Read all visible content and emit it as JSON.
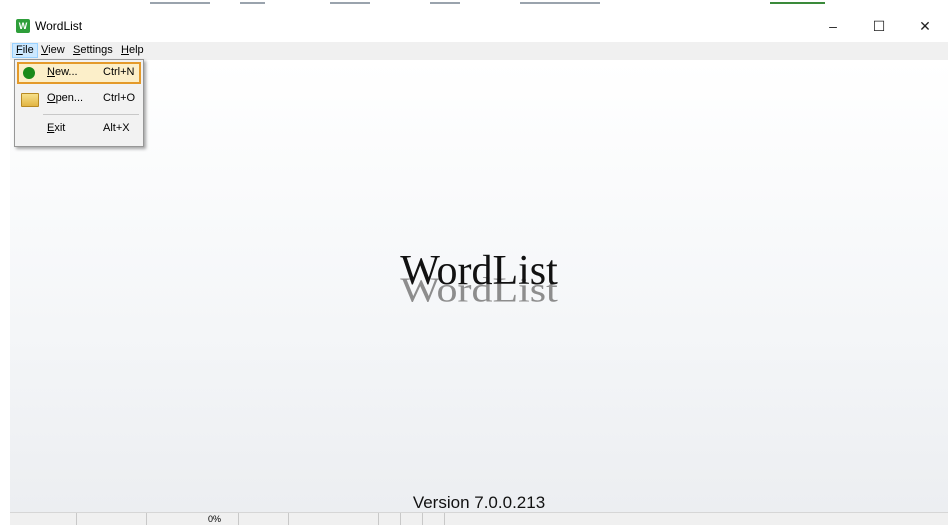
{
  "window": {
    "title": "WordList",
    "icon": "wordlist-app-icon"
  },
  "title_controls": {
    "minimize": "–",
    "maximize": "☐",
    "close": "✕"
  },
  "menubar": {
    "items": [
      {
        "label": "File",
        "mnemonic": "F",
        "rest": "ile"
      },
      {
        "label": "View",
        "mnemonic": "V",
        "rest": "iew"
      },
      {
        "label": "Settings",
        "mnemonic": "S",
        "rest": "ettings"
      },
      {
        "label": "Help",
        "mnemonic": "H",
        "rest": "elp"
      }
    ],
    "open_menu": "File"
  },
  "file_menu": {
    "items": [
      {
        "mnemonic": "N",
        "rest": "ew...",
        "shortcut": "Ctrl+N",
        "icon": "new-green-dot-icon",
        "highlighted": true
      },
      {
        "mnemonic": "O",
        "rest": "pen...",
        "shortcut": "Ctrl+O",
        "icon": "open-folder-icon",
        "highlighted": false
      },
      {
        "mnemonic": "E",
        "rest": "xit",
        "shortcut": "Alt+X",
        "icon": "",
        "highlighted": false
      }
    ]
  },
  "main": {
    "logo_text": "WordList",
    "version": "Version 7.0.0.213"
  },
  "statusbar": {
    "progress": "0%"
  },
  "colors": {
    "menu_highlight_bg": "#fcefc9",
    "menu_highlight_border": "#e49a2a",
    "app_icon": "#2e9e3a"
  }
}
